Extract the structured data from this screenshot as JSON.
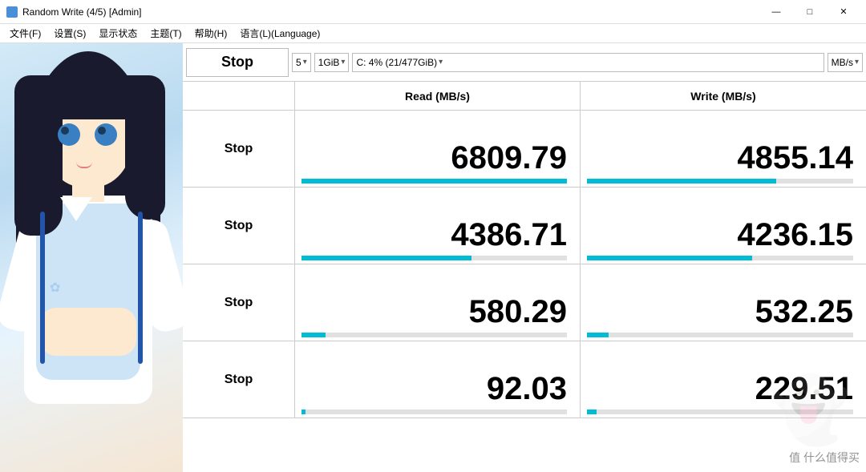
{
  "titlebar": {
    "title": "Random Write (4/5) [Admin]",
    "icon": "disk-icon",
    "controls": {
      "minimize": "—",
      "maximize": "□",
      "close": "✕"
    }
  },
  "menubar": {
    "items": [
      {
        "label": "文件(F)"
      },
      {
        "label": "设置(S)"
      },
      {
        "label": "显示状态"
      },
      {
        "label": "主题(T)"
      },
      {
        "label": "帮助(H)"
      },
      {
        "label": "语言(L)(Language)"
      }
    ]
  },
  "controls": {
    "stop_label": "Stop",
    "queue_depth": "5",
    "block_size": "1GiB",
    "drive": "C: 4% (21/477GiB)",
    "unit": "MB/s"
  },
  "table": {
    "header": {
      "read_label": "Read (MB/s)",
      "write_label": "Write (MB/s)"
    },
    "rows": [
      {
        "btn_label": "Stop",
        "read_value": "6809.79",
        "write_value": "4855.14",
        "read_pct": 100,
        "write_pct": 71
      },
      {
        "btn_label": "Stop",
        "read_value": "4386.71",
        "write_value": "4236.15",
        "read_pct": 64,
        "write_pct": 62
      },
      {
        "btn_label": "Stop",
        "read_value": "580.29",
        "write_value": "532.25",
        "read_pct": 9,
        "write_pct": 8
      },
      {
        "btn_label": "Stop",
        "read_value": "92.03",
        "write_value": "229.51",
        "read_pct": 1,
        "write_pct": 3
      }
    ]
  },
  "watermark": {
    "text": "值 什么值得买"
  },
  "accent_color": "#00bcd4"
}
